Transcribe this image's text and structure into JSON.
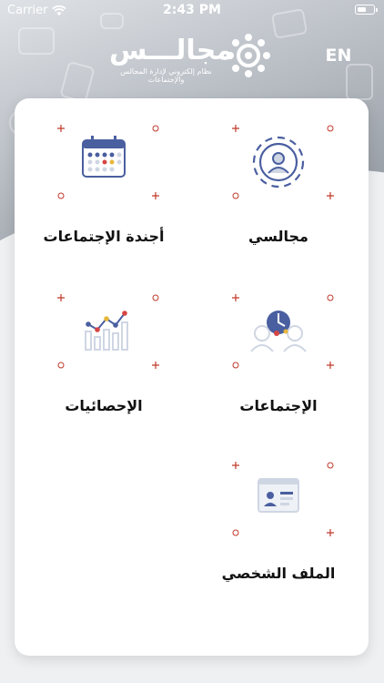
{
  "status_bar": {
    "carrier": "Carrier",
    "time": "2:43 PM"
  },
  "header": {
    "logo_text": "مجالـــس",
    "logo_tagline": "نظام إلكتروني لإدارة المجالس والإجتماعات",
    "language_button": "EN"
  },
  "menu": {
    "my_councils": {
      "label": "مجالسي",
      "icon": "council-gear-person-icon"
    },
    "meetings_agenda": {
      "label": "أجندة الإجتماعات",
      "icon": "calendar-icon"
    },
    "meetings": {
      "label": "الإجتماعات",
      "icon": "meeting-people-icon"
    },
    "statistics": {
      "label": "الإحصائيات",
      "icon": "bar-chart-icon"
    },
    "profile": {
      "label": "الملف الشخصي",
      "icon": "id-card-icon"
    }
  },
  "colors": {
    "icon_blue": "#4a5fa0",
    "icon_light": "#cfd6e3",
    "accent_red": "#d64545",
    "accent_yellow": "#e8b73a",
    "mark_red": "#c0392b"
  }
}
